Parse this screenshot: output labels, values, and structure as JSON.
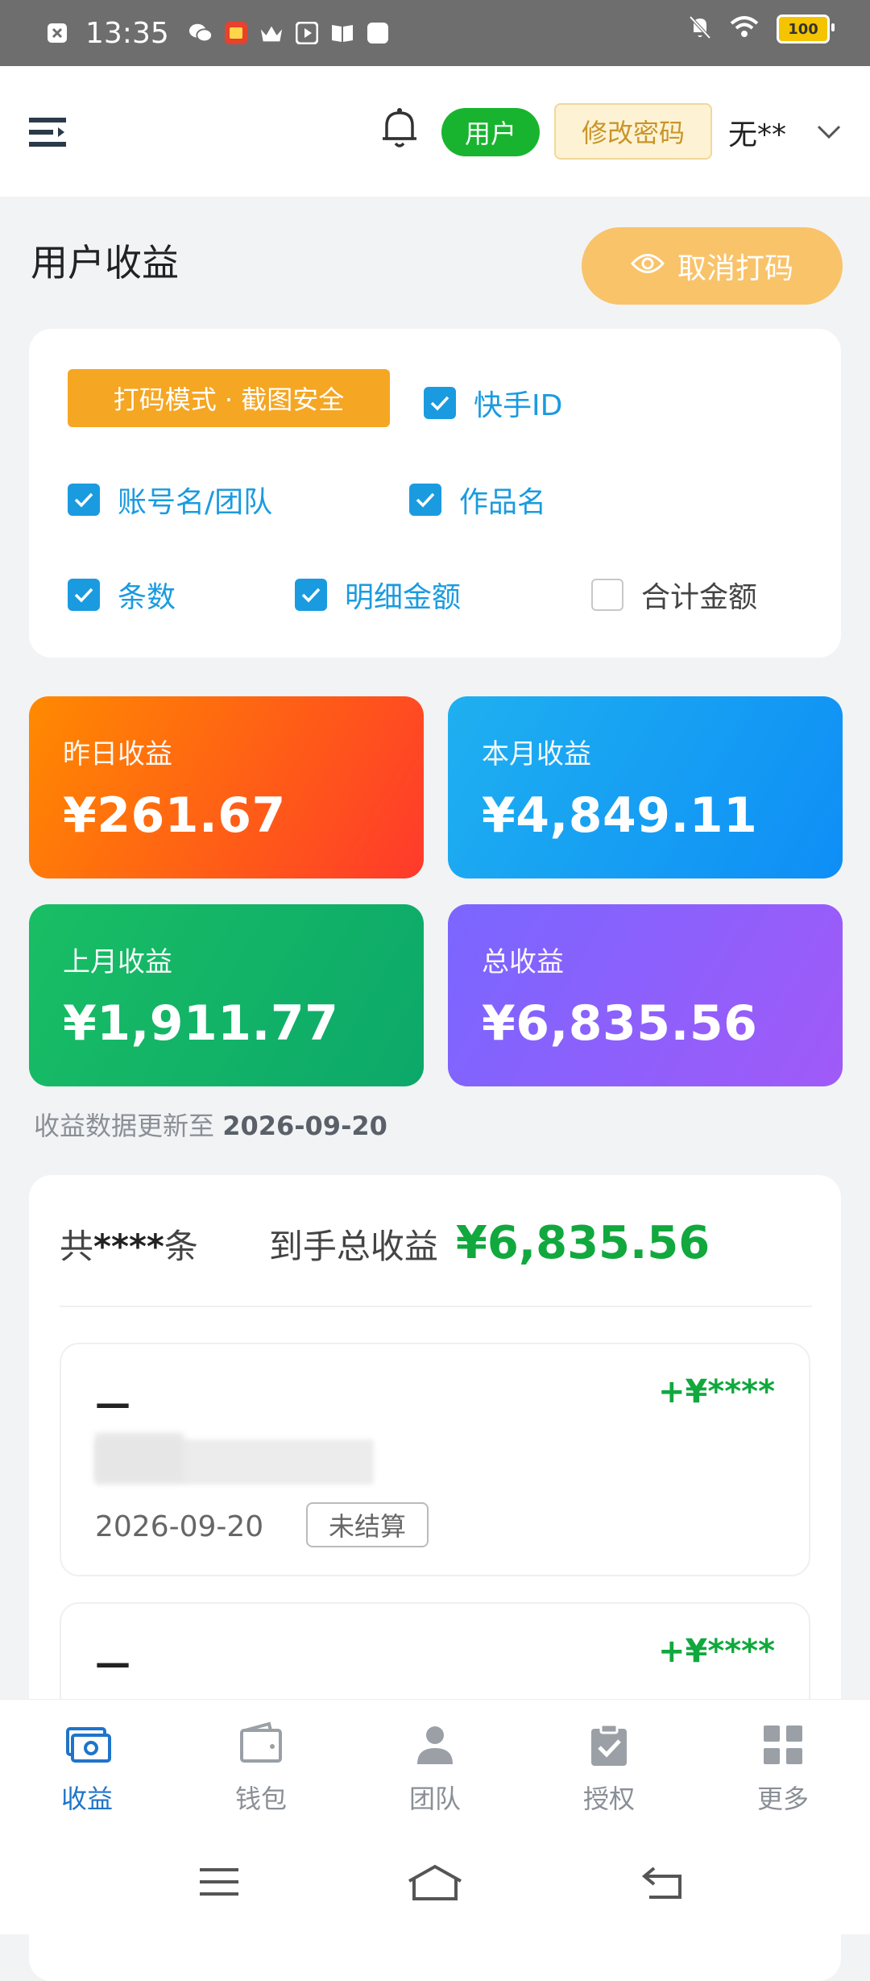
{
  "status_bar": {
    "time": "13:35",
    "battery": "100",
    "icons": [
      "close-box-icon",
      "wechat-icon",
      "app-icon",
      "crown-icon",
      "play-icon",
      "book-icon",
      "square-icon",
      "mute-bell-icon",
      "wifi-icon",
      "battery-icon"
    ]
  },
  "header": {
    "user_badge": "用户",
    "change_password": "修改密码",
    "user_name": "无**"
  },
  "page": {
    "title": "用户收益",
    "mask_button": "取消打码"
  },
  "options": {
    "mode_tag": "打码模式 · 截图安全",
    "items": [
      {
        "label": "快手ID",
        "checked": true
      },
      {
        "label": "账号名/团队",
        "checked": true
      },
      {
        "label": "作品名",
        "checked": true
      },
      {
        "label": "条数",
        "checked": true
      },
      {
        "label": "明细金额",
        "checked": true
      },
      {
        "label": "合计金额",
        "checked": false
      }
    ]
  },
  "stats": {
    "yesterday": {
      "label": "昨日收益",
      "value": "¥261.67"
    },
    "this_month": {
      "label": "本月收益",
      "value": "¥4,849.11"
    },
    "last_month": {
      "label": "上月收益",
      "value": "¥1,911.77"
    },
    "total": {
      "label": "总收益",
      "value": "¥6,835.56"
    }
  },
  "update_note": {
    "prefix": "收益数据更新至 ",
    "date": "2026-09-20"
  },
  "summary": {
    "count_prefix": "共 ",
    "count": "****",
    "count_suffix": " 条",
    "total_label": "到手总收益",
    "total_value": "¥6,835.56"
  },
  "records": [
    {
      "title": "—",
      "amount": "+¥****",
      "date": "2026-09-20",
      "status": "未结算"
    },
    {
      "title": "—",
      "amount": "+¥****"
    }
  ],
  "tabs": [
    {
      "label": "收益",
      "icon": "earnings-icon",
      "active": true
    },
    {
      "label": "钱包",
      "icon": "wallet-icon",
      "active": false
    },
    {
      "label": "团队",
      "icon": "team-icon",
      "active": false
    },
    {
      "label": "授权",
      "icon": "authorize-icon",
      "active": false
    },
    {
      "label": "更多",
      "icon": "more-grid-icon",
      "active": false
    }
  ],
  "colors": {
    "accent_blue": "#1a9be0",
    "green": "#11a83e",
    "orange": "#f5a623",
    "tab_active": "#1f74c9"
  }
}
